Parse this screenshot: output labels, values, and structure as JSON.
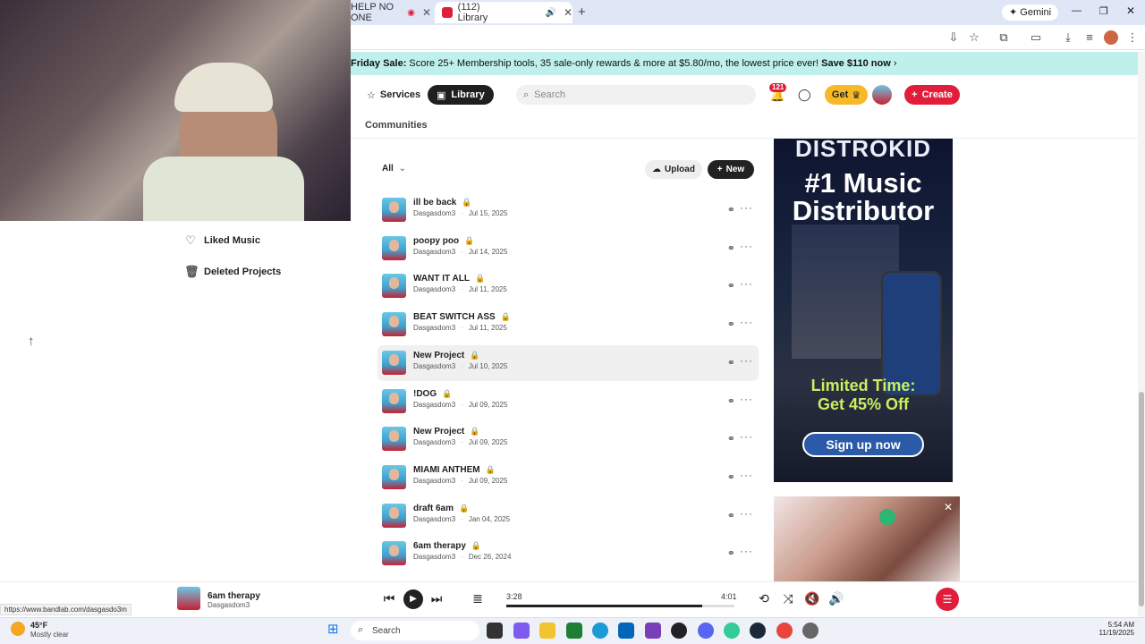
{
  "browser": {
    "tabs": [
      {
        "label": "HELP NO ONE"
      },
      {
        "label": "(112) Library"
      }
    ],
    "gemini_label": "Gemini"
  },
  "promo": {
    "lead": "Friday Sale:",
    "text": " Score 25+ Membership tools, 35 sale-only rewards & more at $5.80/mo, the lowest price ever! ",
    "cta": "Save $110 now"
  },
  "nav": {
    "services": "Services",
    "library": "Library",
    "search_placeholder": "Search",
    "notif_count": "121",
    "get": "Get",
    "create": "Create",
    "communities": "Communities"
  },
  "sidebar": {
    "items": [
      {
        "label": "Liked Music",
        "icon": "heart-icon"
      },
      {
        "label": "Deleted Projects",
        "icon": "trash-icon"
      }
    ]
  },
  "filters": {
    "all": "All",
    "upload": "Upload",
    "new": "New"
  },
  "projects": [
    {
      "title": "ill be back",
      "author": "Dasgasdom3",
      "date": "Jul 15, 2025"
    },
    {
      "title": "poopy poo",
      "author": "Dasgasdom3",
      "date": "Jul 14, 2025"
    },
    {
      "title": "WANT IT ALL",
      "author": "Dasgasdom3",
      "date": "Jul 11, 2025"
    },
    {
      "title": "BEAT SWITCH ASS",
      "author": "Dasgasdom3",
      "date": "Jul 11, 2025"
    },
    {
      "title": "New Project",
      "author": "Dasgasdom3",
      "date": "Jul 10, 2025"
    },
    {
      "title": "!DOG",
      "author": "Dasgasdom3",
      "date": "Jul 09, 2025"
    },
    {
      "title": "New Project",
      "author": "Dasgasdom3",
      "date": "Jul 09, 2025"
    },
    {
      "title": "MIAMI ANTHEM",
      "author": "Dasgasdom3",
      "date": "Jul 09, 2025"
    },
    {
      "title": "draft 6am",
      "author": "Dasgasdom3",
      "date": "Jan 04, 2025"
    },
    {
      "title": "6am therapy",
      "author": "Dasgasdom3",
      "date": "Dec 26, 2024"
    }
  ],
  "ad": {
    "brand": "DISTROKID",
    "headline": "#1 Music Distributor",
    "offer_line1": "Limited Time:",
    "offer_line2": "Get 45% Off",
    "cta": "Sign up now"
  },
  "player": {
    "title": "6am therapy",
    "artist": "Dasgasdom3",
    "elapsed": "3:28",
    "duration": "4:01",
    "progress": 0.86
  },
  "status_url": "https://www.bandlab.com/dasgasdo3m",
  "taskbar": {
    "temp": "45°F",
    "weather": "Mostly clear",
    "search": "Search",
    "time": "5:54 AM",
    "date": "11/19/2025"
  }
}
